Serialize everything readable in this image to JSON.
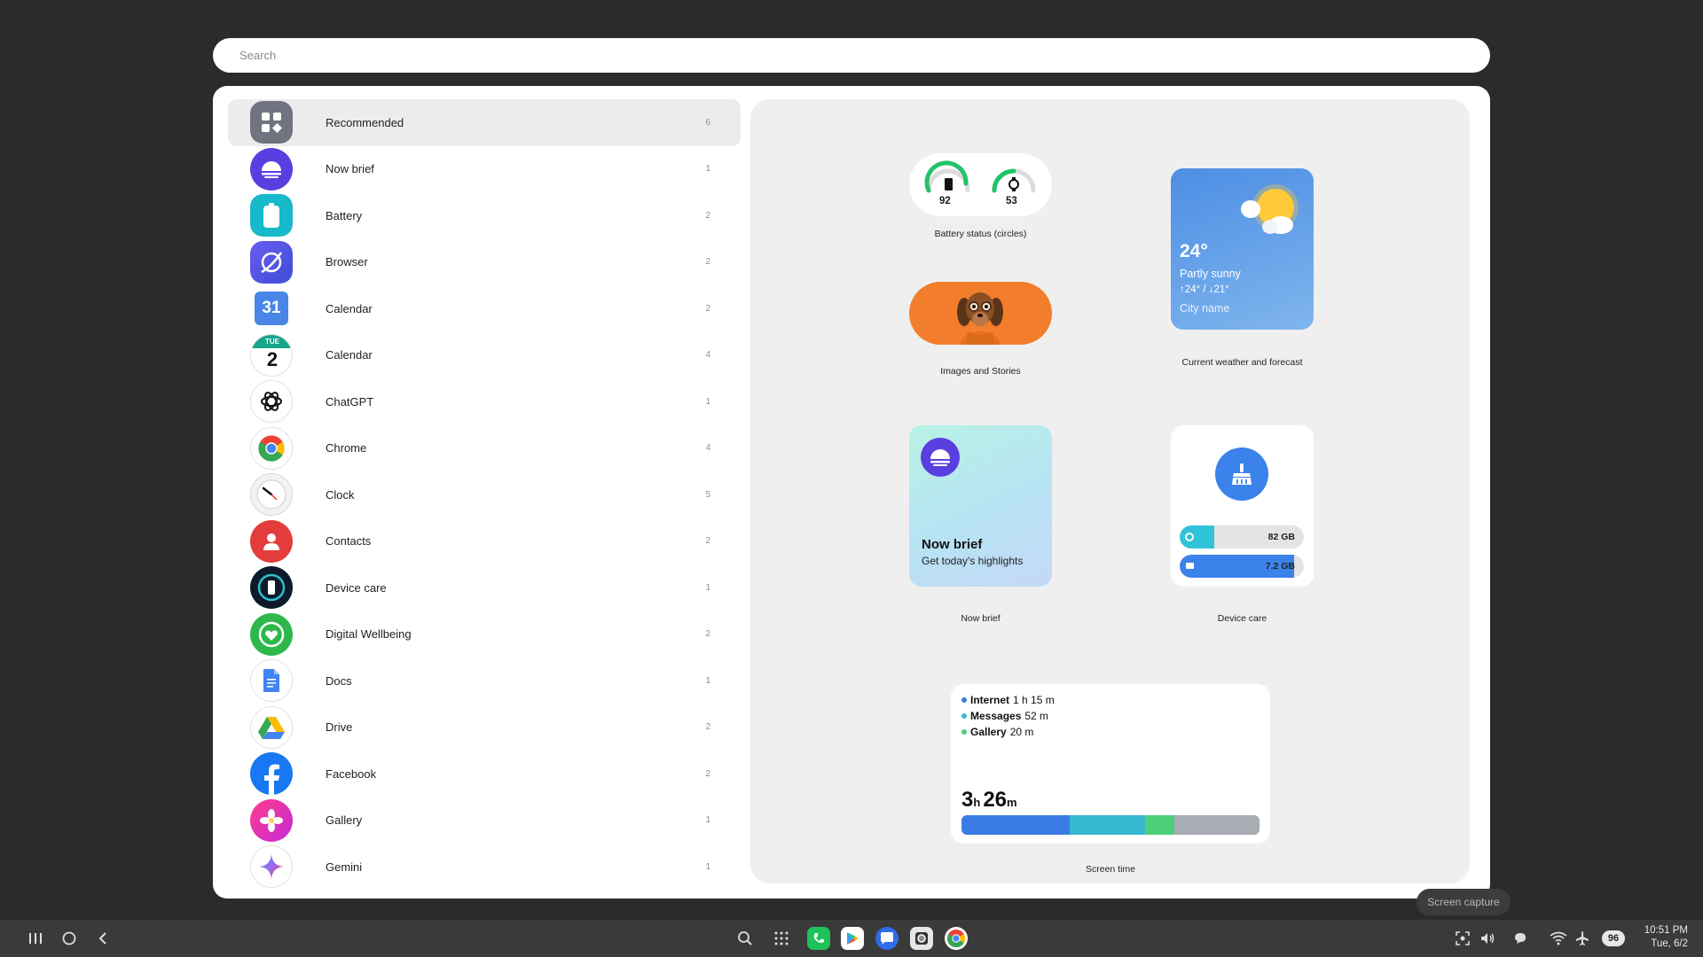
{
  "search": {
    "placeholder": "Search"
  },
  "apps": [
    {
      "name": "Recommended",
      "count": "6",
      "icon": "recommended-grid-icon",
      "selected": true
    },
    {
      "name": "Now brief",
      "count": "1",
      "icon": "now-brief-icon"
    },
    {
      "name": "Battery",
      "count": "2",
      "icon": "battery-icon"
    },
    {
      "name": "Browser",
      "count": "2",
      "icon": "browser-icon"
    },
    {
      "name": "Calendar",
      "count": "2",
      "icon": "google-calendar-icon",
      "badge": "31"
    },
    {
      "name": "Calendar",
      "count": "4",
      "icon": "samsung-calendar-icon",
      "badge_day": "TUE",
      "badge_num": "2"
    },
    {
      "name": "ChatGPT",
      "count": "1",
      "icon": "chatgpt-icon"
    },
    {
      "name": "Chrome",
      "count": "4",
      "icon": "chrome-icon"
    },
    {
      "name": "Clock",
      "count": "5",
      "icon": "clock-icon"
    },
    {
      "name": "Contacts",
      "count": "2",
      "icon": "contacts-icon"
    },
    {
      "name": "Device care",
      "count": "1",
      "icon": "device-care-icon"
    },
    {
      "name": "Digital Wellbeing",
      "count": "2",
      "icon": "digital-wellbeing-icon"
    },
    {
      "name": "Docs",
      "count": "1",
      "icon": "docs-icon"
    },
    {
      "name": "Drive",
      "count": "2",
      "icon": "drive-icon"
    },
    {
      "name": "Facebook",
      "count": "2",
      "icon": "facebook-icon"
    },
    {
      "name": "Gallery",
      "count": "1",
      "icon": "gallery-icon"
    },
    {
      "name": "Gemini",
      "count": "1",
      "icon": "gemini-icon"
    }
  ],
  "widgets": {
    "battery": {
      "label": "Battery status (circles)",
      "phone_level": "92",
      "watch_level": "53"
    },
    "images": {
      "label": "Images and Stories"
    },
    "weather": {
      "label": "Current weather and forecast",
      "temp": "24°",
      "condition": "Partly sunny",
      "range": "↑24° / ↓21°",
      "city": "City name"
    },
    "now_brief": {
      "label": "Now brief",
      "title": "Now brief",
      "subtitle": "Get today's highlights"
    },
    "device_care": {
      "label": "Device care",
      "storage": "82 GB",
      "memory": "7.2 GB",
      "storage_fraction": 0.28,
      "memory_fraction": 0.92
    },
    "screen_time": {
      "label": "Screen time",
      "hours": "3",
      "hours_unit": "h",
      "minutes": "26",
      "minutes_unit": "m",
      "items": [
        {
          "name": "Internet",
          "time": "1 h 15 m",
          "color": "#3a7be6"
        },
        {
          "name": "Messages",
          "time": "52 m",
          "color": "#36b8d0"
        },
        {
          "name": "Gallery",
          "time": "20 m",
          "color": "#4fcf7a"
        }
      ],
      "other_color": "#a8acb3"
    }
  },
  "tooltip": {
    "text": "Screen capture"
  },
  "taskbar": {
    "battery": "96",
    "time": "10:51 PM",
    "date": "Tue, 6/2"
  },
  "colors": {
    "accent": "#3a7be6",
    "panel_bg": "#efeff0"
  }
}
